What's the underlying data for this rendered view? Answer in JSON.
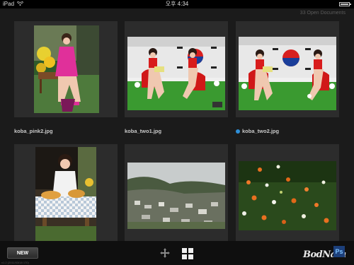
{
  "status_bar": {
    "device": "iPad",
    "time": "오후 4:34"
  },
  "doc_count": "33 Open Documents",
  "documents": [
    {
      "filename": "koba_pink2.jpg",
      "selected": false
    },
    {
      "filename": "koba_two1.jpg",
      "selected": false
    },
    {
      "filename": "koba_two2.jpg",
      "selected": true
    },
    {
      "filename": "",
      "selected": false
    },
    {
      "filename": "",
      "selected": false
    },
    {
      "filename": "",
      "selected": false
    }
  ],
  "toolbar": {
    "new_label": "NEW",
    "version": "v1.2 (2011/03/18 170)",
    "move_icon": "move-arrows-icon",
    "grid_icon": "grid-view-icon"
  },
  "watermark": {
    "text": "BodNara",
    "badge": "Ps"
  },
  "colors": {
    "accent": "#2e8fd8",
    "background": "#1b1b1b",
    "card": "#2c2c2c"
  }
}
